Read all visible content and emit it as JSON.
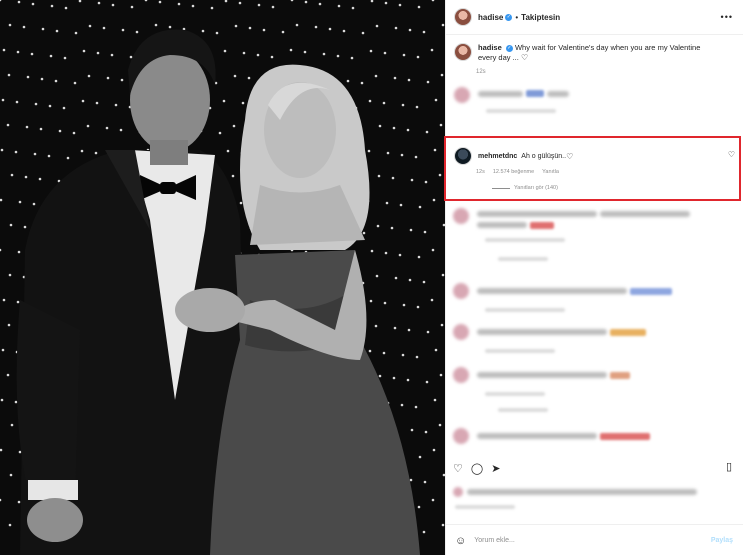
{
  "post": {
    "username": "hadise",
    "follow_status": "Takiptesin",
    "caption": "Why wait for Valentine's day when you are my Valentine every day ...",
    "caption_time": "12s"
  },
  "highlighted_comment": {
    "username": "mehmetdnc",
    "text": "Ah o gülüşün..",
    "time": "12s",
    "likes": "12.574 beğenme",
    "reply": "Yanıtla",
    "view_replies": "Yanıtları gör (140)"
  },
  "footer": {
    "comment_placeholder": "Yorum ekle...",
    "post_label": "Paylaş"
  },
  "icons": {
    "more": "more-options-icon",
    "heart": "heart-icon",
    "comment": "comment-icon",
    "share": "share-icon",
    "save": "bookmark-icon",
    "emoji": "emoji-icon"
  },
  "colors": {
    "highlight_border": "#e0262d",
    "verified": "#3897f0"
  }
}
